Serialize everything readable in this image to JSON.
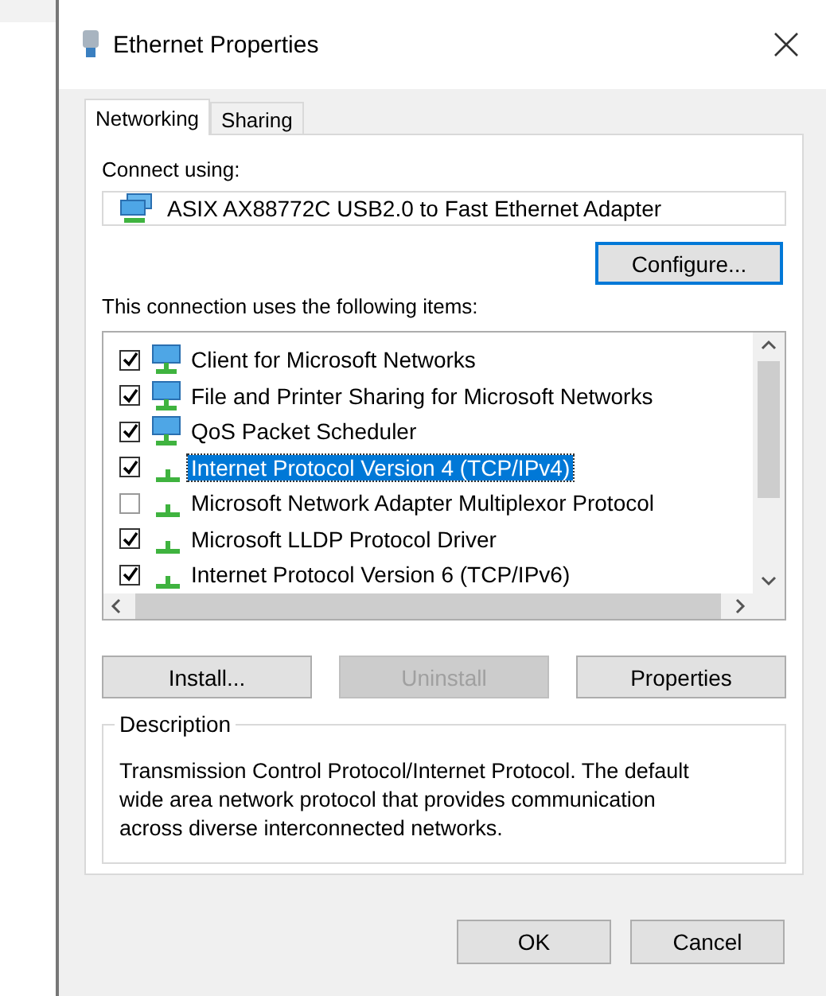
{
  "window": {
    "title": "Ethernet Properties"
  },
  "tabs": [
    {
      "label": "Networking",
      "selected": true
    },
    {
      "label": "Sharing",
      "selected": false
    }
  ],
  "connect_using": {
    "label": "Connect using:",
    "adapter": "ASIX AX88772C USB2.0 to Fast Ethernet Adapter",
    "configure_button": "Configure..."
  },
  "items_label": "This connection uses the following items:",
  "items": [
    {
      "kind": "client",
      "label": "Client for Microsoft Networks",
      "checked": true,
      "selected": false
    },
    {
      "kind": "service",
      "label": "File and Printer Sharing for Microsoft Networks",
      "checked": true,
      "selected": false
    },
    {
      "kind": "service",
      "label": "QoS Packet Scheduler",
      "checked": true,
      "selected": false
    },
    {
      "kind": "protocol",
      "label": "Internet Protocol Version 4 (TCP/IPv4)",
      "checked": true,
      "selected": true
    },
    {
      "kind": "protocol",
      "label": "Microsoft Network Adapter Multiplexor Protocol",
      "checked": false,
      "selected": false
    },
    {
      "kind": "protocol",
      "label": "Microsoft LLDP Protocol Driver",
      "checked": true,
      "selected": false
    },
    {
      "kind": "protocol",
      "label": "Internet Protocol Version 6 (TCP/IPv6)",
      "checked": true,
      "selected": false
    }
  ],
  "item_buttons": [
    {
      "label": "Install...",
      "disabled": false
    },
    {
      "label": "Uninstall",
      "disabled": true
    },
    {
      "label": "Properties",
      "disabled": false
    }
  ],
  "description": {
    "title": "Description",
    "text": "Transmission Control Protocol/Internet Protocol. The default wide area network protocol that provides communication across diverse interconnected networks."
  },
  "buttons": [
    "OK",
    "Cancel"
  ]
}
